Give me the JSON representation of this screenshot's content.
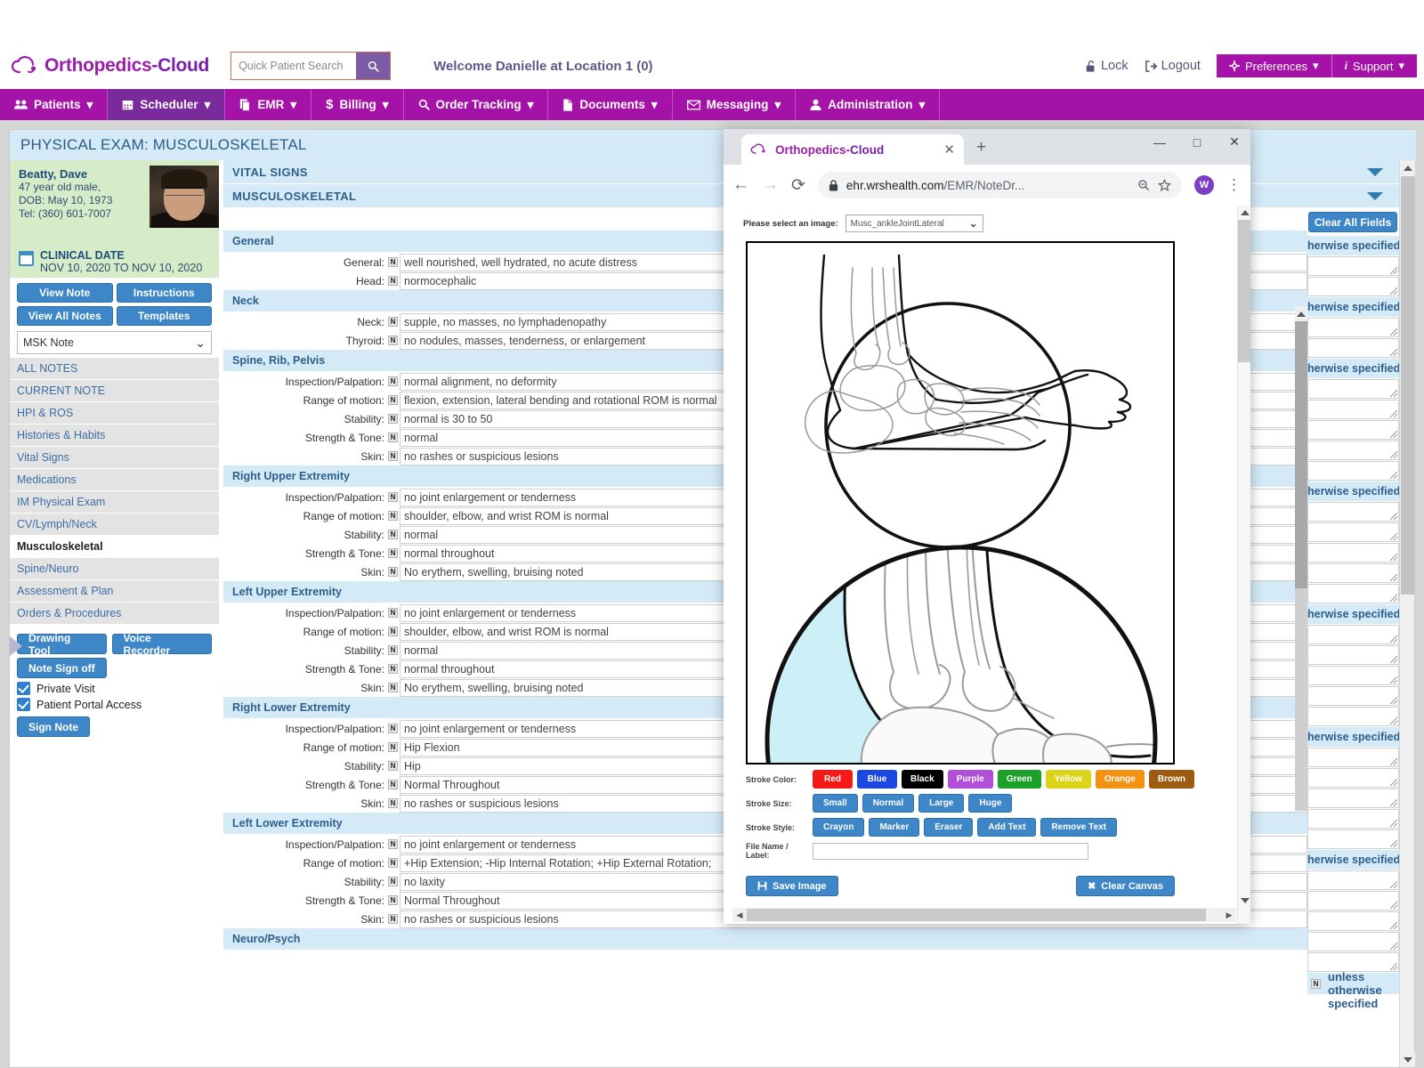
{
  "app": {
    "brand_a": "Orthopedics",
    "brand_b": "-Cloud",
    "welcome": "Welcome Danielle at Location 1 (0)"
  },
  "search": {
    "placeholder": "Quick Patient Search",
    "value": "",
    "icon": "search-icon"
  },
  "header_links": [
    {
      "label": "Lock",
      "icon": "lock-open-icon"
    },
    {
      "label": "Logout",
      "icon": "logout-icon"
    }
  ],
  "header_pills": [
    {
      "label": "Preferences",
      "icon": "gear-icon",
      "caret": "▾"
    },
    {
      "label": "Support",
      "icon": "info-icon",
      "caret": "▾"
    }
  ],
  "nav": [
    {
      "label": "Patients",
      "icon": "people-icon",
      "caret": "▾",
      "active": false
    },
    {
      "label": "Scheduler",
      "icon": "calendar-icon",
      "caret": "▾",
      "active": true
    },
    {
      "label": "EMR",
      "icon": "document-copy-icon",
      "caret": "▾",
      "active": false
    },
    {
      "label": "Billing",
      "icon": "dollar-icon",
      "caret": "▾",
      "active": false
    },
    {
      "label": "Order Tracking",
      "icon": "search-icon",
      "caret": "▾",
      "active": false
    },
    {
      "label": "Documents",
      "icon": "file-icon",
      "caret": "▾",
      "active": false
    },
    {
      "label": "Messaging",
      "icon": "envelope-icon",
      "caret": "▾",
      "active": false
    },
    {
      "label": "Administration",
      "icon": "user-icon",
      "caret": "▾",
      "active": false
    }
  ],
  "exam": {
    "title": "PHYSICAL EXAM: MUSCULOSKELETAL"
  },
  "patient": {
    "name": "Beatty, Dave",
    "age_sex": "47 year old male,",
    "dob": "DOB: May 10, 1973",
    "tel": "Tel: (360) 601-7007",
    "clinical_date_label": "CLINICAL DATE",
    "clinical_date_value": "NOV 10, 2020 TO NOV 10, 2020"
  },
  "sidebar": {
    "buttons": [
      "View Note",
      "Instructions",
      "View All Notes",
      "Templates"
    ],
    "note_select": {
      "value": "MSK Note",
      "caret": "⌄"
    },
    "items": [
      {
        "label": "ALL NOTES",
        "selected": false
      },
      {
        "label": "CURRENT NOTE",
        "selected": false
      },
      {
        "label": "HPI & ROS",
        "selected": false
      },
      {
        "label": "Histories & Habits",
        "selected": false
      },
      {
        "label": "Vital Signs",
        "selected": false
      },
      {
        "label": "Medications",
        "selected": false
      },
      {
        "label": "IM Physical Exam",
        "selected": false
      },
      {
        "label": "CV/Lymph/Neck",
        "selected": false
      },
      {
        "label": "Musculoskeletal",
        "selected": true
      },
      {
        "label": "Spine/Neuro",
        "selected": false
      },
      {
        "label": "Assessment & Plan",
        "selected": false
      },
      {
        "label": "Orders & Procedures",
        "selected": false
      }
    ],
    "tools": [
      "Drawing Tool",
      "Voice Recorder"
    ],
    "note_signoff": "Note Sign off",
    "checkboxes": [
      {
        "label": "Private Visit",
        "checked": true
      },
      {
        "label": "Patient Portal Access",
        "checked": true
      }
    ],
    "sign_note": "Sign Note"
  },
  "form": {
    "top_bars": [
      "VITAL SIGNS",
      "MUSCULOSKELETAL"
    ],
    "n_badge": "N",
    "sections": [
      {
        "title": "General",
        "rows": [
          {
            "label": "General:",
            "value": "well nourished, well hydrated, no acute distress"
          },
          {
            "label": "Head:",
            "value": "normocephalic"
          }
        ]
      },
      {
        "title": "Neck",
        "rows": [
          {
            "label": "Neck:",
            "value": "supple, no masses, no lymphadenopathy"
          },
          {
            "label": "Thyroid:",
            "value": "no nodules, masses, tenderness, or enlargement"
          }
        ]
      },
      {
        "title": "Spine, Rib, Pelvis",
        "rows": [
          {
            "label": "Inspection/Palpation:",
            "value": "normal alignment, no deformity"
          },
          {
            "label": "Range of motion:",
            "value": "flexion, extension, lateral bending and rotational ROM is normal"
          },
          {
            "label": "Stability:",
            "value": "normal is 30 to 50"
          },
          {
            "label": "Strength & Tone:",
            "value": "normal"
          },
          {
            "label": "Skin:",
            "value": "no rashes or suspicious lesions"
          }
        ]
      },
      {
        "title": "Right Upper Extremity",
        "rows": [
          {
            "label": "Inspection/Palpation:",
            "value": "no joint enlargement or tenderness"
          },
          {
            "label": "Range of motion:",
            "value": "shoulder, elbow, and wrist ROM is normal"
          },
          {
            "label": "Stability:",
            "value": "normal"
          },
          {
            "label": "Strength & Tone:",
            "value": "normal throughout"
          },
          {
            "label": "Skin:",
            "value": "No erythem, swelling, bruising noted"
          }
        ]
      },
      {
        "title": "Left Upper Extremity",
        "rows": [
          {
            "label": "Inspection/Palpation:",
            "value": "no joint enlargement or tenderness"
          },
          {
            "label": "Range of motion:",
            "value": "shoulder, elbow, and wrist ROM is normal"
          },
          {
            "label": "Stability:",
            "value": "normal"
          },
          {
            "label": "Strength & Tone:",
            "value": "normal throughout"
          },
          {
            "label": "Skin:",
            "value": "No erythem, swelling, bruising noted"
          }
        ]
      },
      {
        "title": "Right Lower Extremity",
        "rows": [
          {
            "label": "Inspection/Palpation:",
            "value": "no joint enlargement or tenderness"
          },
          {
            "label": "Range of motion:",
            "value": "Hip Flexion"
          },
          {
            "label": "Stability:",
            "value": "Hip"
          },
          {
            "label": "Strength & Tone:",
            "value": "Normal Throughout"
          },
          {
            "label": "Skin:",
            "value": "no rashes or suspicious lesions"
          }
        ]
      },
      {
        "title": "Left Lower Extremity",
        "rows": [
          {
            "label": "Inspection/Palpation:",
            "value": "no joint enlargement or tenderness"
          },
          {
            "label": "Range of motion:",
            "value": "+Hip Extension; -Hip Internal Rotation; +Hip External Rotation;"
          },
          {
            "label": "Stability:",
            "value": "no laxity"
          },
          {
            "label": "Strength & Tone:",
            "value": "Normal Throughout"
          },
          {
            "label": "Skin:",
            "value": "no rashes or suspicious lesions"
          }
        ]
      },
      {
        "title": "Neuro/Psych",
        "rows": []
      }
    ]
  },
  "right_column": {
    "clear_all": "Clear All Fields",
    "band_text": "herwise specified",
    "normal_note": "Normal unless otherwise specified",
    "caret": "▼"
  },
  "popup": {
    "tab_title_a": "Orthopedics",
    "tab_title_b": "-Cloud",
    "tab_close": "✕",
    "new_tab": "+",
    "window_controls": {
      "minimize": "—",
      "maximize": "□",
      "close": "✕"
    },
    "toolbar": {
      "back": "←",
      "forward": "→",
      "reload": "⟳",
      "lock_icon": "lock-icon",
      "url_host": "ehr.wrshealth.com",
      "url_path": "/EMR/NoteDr...",
      "zoom_icon": "zoom-icon",
      "star_icon": "star-icon",
      "avatar_letter": "W",
      "menu_icon": "kebab-menu-icon"
    },
    "image_select": {
      "label": "Please select an image:",
      "value": "Musc_ankleJointLateral",
      "caret": "⌄"
    },
    "stroke_color": {
      "label": "Stroke Color:",
      "options": [
        {
          "label": "Red",
          "color": "#f71818"
        },
        {
          "label": "Blue",
          "color": "#1a48e0"
        },
        {
          "label": "Black",
          "color": "#000000"
        },
        {
          "label": "Purple",
          "color": "#b04fd8"
        },
        {
          "label": "Green",
          "color": "#1ba028"
        },
        {
          "label": "Yellow",
          "color": "#dbd41a"
        },
        {
          "label": "Orange",
          "color": "#f39113"
        },
        {
          "label": "Brown",
          "color": "#9e5a10"
        }
      ]
    },
    "stroke_size": {
      "label": "Stroke Size:",
      "options": [
        "Small",
        "Normal",
        "Large",
        "Huge"
      ]
    },
    "stroke_style": {
      "label": "Stroke Style:",
      "options": [
        "Crayon",
        "Marker",
        "Eraser",
        "Add Text",
        "Remove Text"
      ]
    },
    "file_name": {
      "label": "File Name / Label:",
      "value": "",
      "placeholder": ""
    },
    "save_image": {
      "label": "Save Image",
      "icon": "save-icon"
    },
    "clear_canvas": {
      "label": "Clear Canvas",
      "icon": "x-icon"
    }
  }
}
